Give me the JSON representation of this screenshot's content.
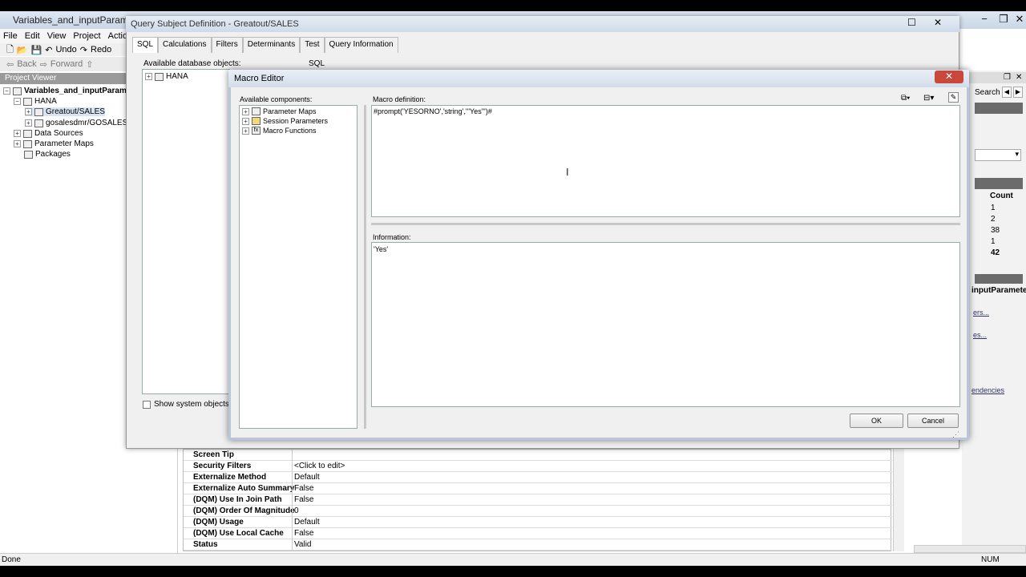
{
  "app": {
    "title": "Variables_and_inputParameters",
    "menu": [
      "File",
      "Edit",
      "View",
      "Project",
      "Action"
    ],
    "toolbar": {
      "undo": "Undo",
      "redo": "Redo",
      "back": "Back",
      "forward": "Forward"
    },
    "project_viewer_label": "Project Viewer",
    "tree": [
      {
        "label": "Variables_and_inputParameters",
        "level": 0
      },
      {
        "label": "HANA",
        "level": 1
      },
      {
        "label": "Greatout/SALES",
        "level": 2
      },
      {
        "label": "gosalesdmr/GOSALES",
        "level": 2
      },
      {
        "label": "Data Sources",
        "level": 1
      },
      {
        "label": "Parameter Maps",
        "level": 1
      },
      {
        "label": "Packages",
        "level": 1
      }
    ],
    "status": "Done",
    "num": "NUM"
  },
  "properties": [
    {
      "key": "Screen Tip",
      "value": ""
    },
    {
      "key": "Security Filters",
      "value": "<Click to edit>"
    },
    {
      "key": "Externalize Method",
      "value": "Default"
    },
    {
      "key": "Externalize Auto Summary",
      "value": "False"
    },
    {
      "key": "(DQM) Use In Join Path",
      "value": "False"
    },
    {
      "key": "(DQM) Order Of Magnitude",
      "value": "0"
    },
    {
      "key": "(DQM) Usage",
      "value": "Default"
    },
    {
      "key": "(DQM) Use Local Cache",
      "value": "False"
    },
    {
      "key": "Status",
      "value": "Valid"
    }
  ],
  "right": {
    "search": "Search",
    "count_header": "Count",
    "counts": [
      "1",
      "2",
      "38",
      "1",
      "42"
    ],
    "params_label": "inputParameter",
    "link1": "ers...",
    "link2": "es...",
    "deps": "endencies"
  },
  "qsd": {
    "title": "Query Subject Definition - Greatout/SALES",
    "tabs": [
      "SQL",
      "Calculations",
      "Filters",
      "Determinants",
      "Test",
      "Query Information"
    ],
    "available_label": "Available database objects:",
    "sql_label": "SQL",
    "db_node": "HANA",
    "show_system": "Show system objects"
  },
  "macro": {
    "title": "Macro Editor",
    "components_label": "Available components:",
    "components": [
      "Parameter Maps",
      "Session Parameters",
      "Macro Functions"
    ],
    "definition_label": "Macro definition:",
    "definition": "#prompt('YESORNO','string','''Yes''')#",
    "information_label": "Information:",
    "information": "'Yes'",
    "ok": "OK",
    "cancel": "Cancel"
  }
}
